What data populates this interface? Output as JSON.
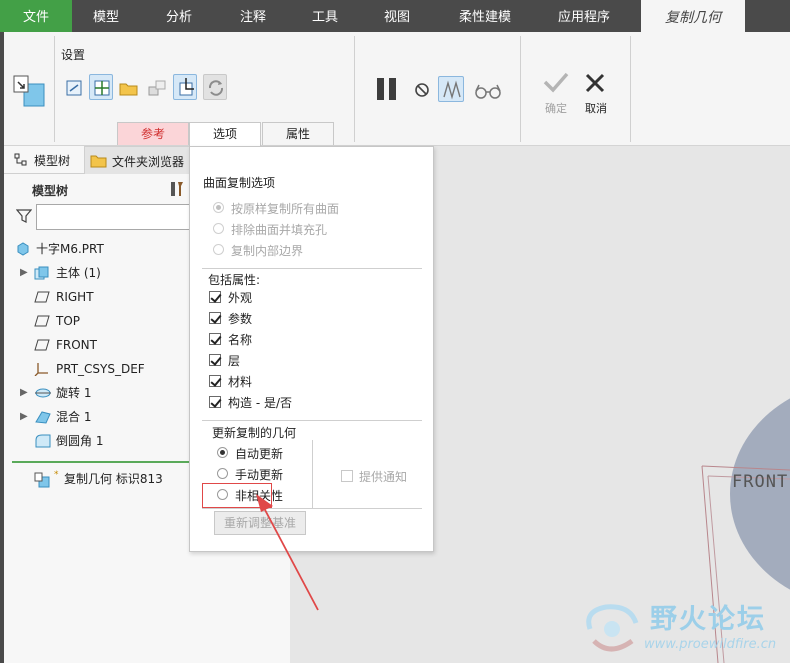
{
  "ribbon": {
    "tabs": [
      "文件",
      "模型",
      "分析",
      "注释",
      "工具",
      "视图",
      "柔性建模",
      "应用程序"
    ],
    "active_tab": "复制几何",
    "group_label": "设置",
    "confirm_label": "确定",
    "cancel_label": "取消",
    "sub_tabs": [
      "参考",
      "选项",
      "属性"
    ]
  },
  "model_tree": {
    "tabs": [
      "模型树",
      "文件夹浏览器"
    ],
    "title": "模型树",
    "filter_value": "",
    "items": [
      {
        "label": "十字M6.PRT",
        "icon": "part-icon"
      },
      {
        "label": "主体 (1)",
        "icon": "body-icon"
      },
      {
        "label": "RIGHT",
        "icon": "datum-plane-icon"
      },
      {
        "label": "TOP",
        "icon": "datum-plane-icon"
      },
      {
        "label": "FRONT",
        "icon": "datum-plane-icon"
      },
      {
        "label": "PRT_CSYS_DEF",
        "icon": "csys-icon"
      },
      {
        "label": "旋转 1",
        "icon": "revolve-icon"
      },
      {
        "label": "混合 1",
        "icon": "blend-icon"
      },
      {
        "label": "倒圆角 1",
        "icon": "round-icon"
      }
    ],
    "insert_marker": "*",
    "last_item": "复制几何 标识813"
  },
  "options_panel": {
    "surface_title": "曲面复制选项",
    "surface_options": [
      "按原样复制所有曲面",
      "排除曲面并填充孔",
      "复制内部边界"
    ],
    "include_title": "包括属性:",
    "include_items": [
      "外观",
      "参数",
      "名称",
      "层",
      "材料",
      "构造 - 是/否"
    ],
    "update_title": "更新复制的几何",
    "update_options": [
      "自动更新",
      "手动更新",
      "非相关性"
    ],
    "notify_label": "提供通知",
    "reroute_button": "重新调整基准"
  },
  "graphics": {
    "plane_label": "FRONT"
  },
  "watermark": {
    "title": "野火论坛",
    "url": "www.proewildfire.cn"
  },
  "colors": {
    "file_tab": "#43a047",
    "ribbon_dark": "#4a4a4a",
    "ref_tab_bg": "#fbd5d8",
    "ref_tab_text": "#d03030",
    "annotation_red": "#e04848",
    "part_surface": "#a3acbd"
  }
}
